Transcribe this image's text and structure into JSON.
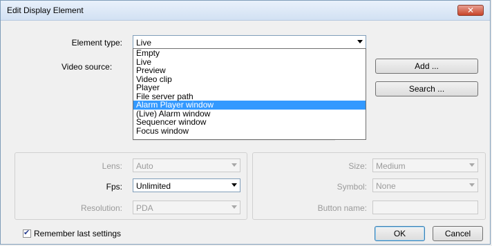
{
  "window": {
    "title": "Edit Display Element",
    "close_glyph": "✕"
  },
  "element_type": {
    "label": "Element type:",
    "value": "Live",
    "options": [
      "Empty",
      "Live",
      "Preview",
      "Video clip",
      "Player",
      "File server path",
      "Alarm Player window",
      "(Live) Alarm window",
      "Sequencer window",
      "Focus window"
    ],
    "highlighted": "Alarm Player window"
  },
  "video_source": {
    "label": "Video source:"
  },
  "buttons": {
    "add": "Add ...",
    "search": "Search ...",
    "ok": "OK",
    "cancel": "Cancel"
  },
  "left_group": {
    "lens": {
      "label": "Lens:",
      "value": "Auto"
    },
    "fps": {
      "label": "Fps:",
      "value": "Unlimited"
    },
    "resolution": {
      "label": "Resolution:",
      "value": "PDA"
    }
  },
  "right_group": {
    "size": {
      "label": "Size:",
      "value": "Medium"
    },
    "symbol": {
      "label": "Symbol:",
      "value": "None"
    },
    "button_name": {
      "label": "Button name:",
      "value": ""
    }
  },
  "remember": {
    "label": "Remember last settings",
    "checked": true,
    "check_glyph": "✔"
  },
  "colors": {
    "highlight": "#3399ff",
    "close_button": "#c7442a"
  }
}
